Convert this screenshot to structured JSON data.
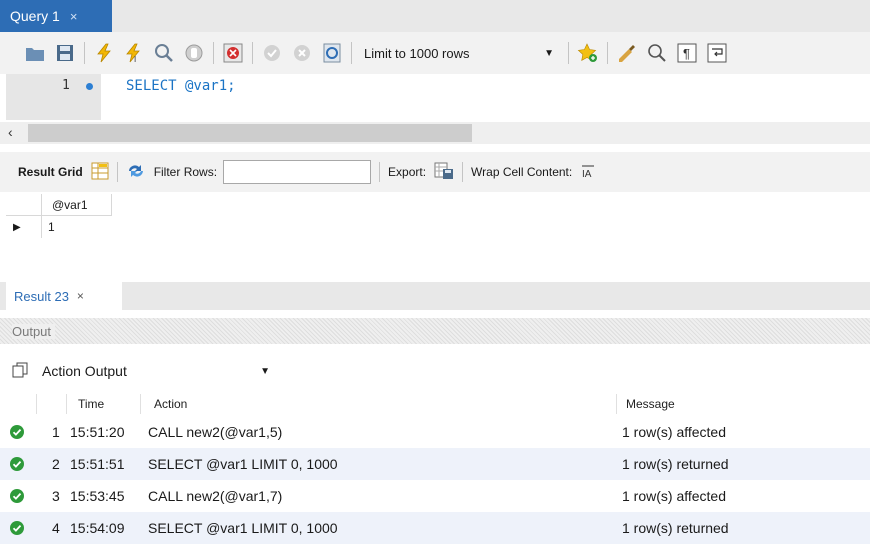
{
  "query_tab": {
    "label": "Query 1",
    "close": "×"
  },
  "toolbar": {
    "limit_select": "Limit to 1000 rows",
    "colors": {
      "bolt": "#f2b705",
      "accent": "#2d6db5"
    }
  },
  "editor": {
    "line_number": "1",
    "code": "SELECT @var1;"
  },
  "result_toolbar": {
    "result_grid": "Result Grid",
    "filter_rows": "Filter Rows:",
    "filter_value": "",
    "export": "Export:",
    "wrap": "Wrap Cell Content:"
  },
  "grid": {
    "column": "@var1",
    "value": "1"
  },
  "result_tab": {
    "label": "Result 23",
    "close": "×"
  },
  "output": {
    "header": "Output",
    "mode": "Action Output",
    "columns": {
      "time": "Time",
      "action": "Action",
      "message": "Message"
    },
    "rows": [
      {
        "n": "1",
        "time": "15:51:20",
        "action": "CALL new2(@var1,5)",
        "message": "1 row(s) affected"
      },
      {
        "n": "2",
        "time": "15:51:51",
        "action": "SELECT @var1 LIMIT 0, 1000",
        "message": "1 row(s) returned"
      },
      {
        "n": "3",
        "time": "15:53:45",
        "action": "CALL new2(@var1,7)",
        "message": "1 row(s) affected"
      },
      {
        "n": "4",
        "time": "15:54:09",
        "action": "SELECT @var1 LIMIT 0, 1000",
        "message": "1 row(s) returned"
      }
    ]
  }
}
